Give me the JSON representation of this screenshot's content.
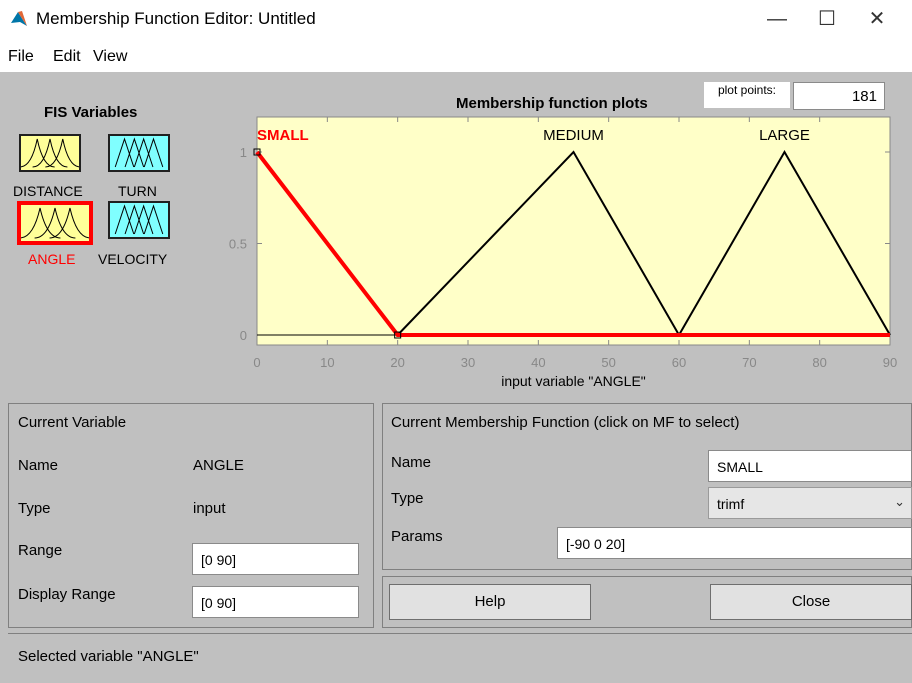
{
  "window": {
    "title": "Membership Function Editor: Untitled",
    "minimize": "—",
    "maximize": "☐",
    "close": "✕"
  },
  "menu": [
    "File",
    "Edit",
    "View"
  ],
  "fis": {
    "title": "FIS Variables",
    "variables": [
      {
        "label": "DISTANCE",
        "kind": "input",
        "selected": false
      },
      {
        "label": "TURN",
        "kind": "output",
        "selected": false
      },
      {
        "label": "ANGLE",
        "kind": "input",
        "selected": true
      },
      {
        "label": "VELOCITY",
        "kind": "output",
        "selected": false
      }
    ],
    "colors": {
      "input": "#ffff99",
      "output": "#80ffff",
      "selected": "#ff0000"
    }
  },
  "plot": {
    "title": "Membership function plots",
    "points_label": "plot points:",
    "points_value": "181",
    "xlabel": "input variable \"ANGLE\""
  },
  "chart_data": {
    "type": "line",
    "xlim": [
      0,
      90
    ],
    "ylim": [
      0,
      1
    ],
    "xticks": [
      "0",
      "10",
      "20",
      "30",
      "40",
      "50",
      "60",
      "70",
      "80",
      "90"
    ],
    "yticks": [
      "0",
      "0.5",
      "1"
    ],
    "background": "#ffffc8",
    "series": [
      {
        "name": "SMALL",
        "selected": true,
        "color": "#ff0000",
        "x": [
          0,
          20,
          90
        ],
        "y": [
          1,
          0,
          0
        ]
      },
      {
        "name": "MEDIUM",
        "selected": false,
        "color": "#000000",
        "x": [
          20,
          45,
          60
        ],
        "y": [
          0,
          1,
          0
        ]
      },
      {
        "name": "LARGE",
        "selected": false,
        "color": "#000000",
        "x": [
          60,
          75,
          90
        ],
        "y": [
          0,
          1,
          0
        ]
      }
    ]
  },
  "current_variable": {
    "heading": "Current Variable",
    "name_label": "Name",
    "name_value": "ANGLE",
    "type_label": "Type",
    "type_value": "input",
    "range_label": "Range",
    "range_value": "[0 90]",
    "display_range_label": "Display Range",
    "display_range_value": "[0 90]"
  },
  "current_mf": {
    "heading": "Current Membership Function (click on MF to select)",
    "name_label": "Name",
    "name_value": "SMALL",
    "type_label": "Type",
    "type_value": "trimf",
    "params_label": "Params",
    "params_value": "[-90 0 20]"
  },
  "buttons": {
    "help": "Help",
    "close": "Close"
  },
  "status": "Selected variable \"ANGLE\""
}
